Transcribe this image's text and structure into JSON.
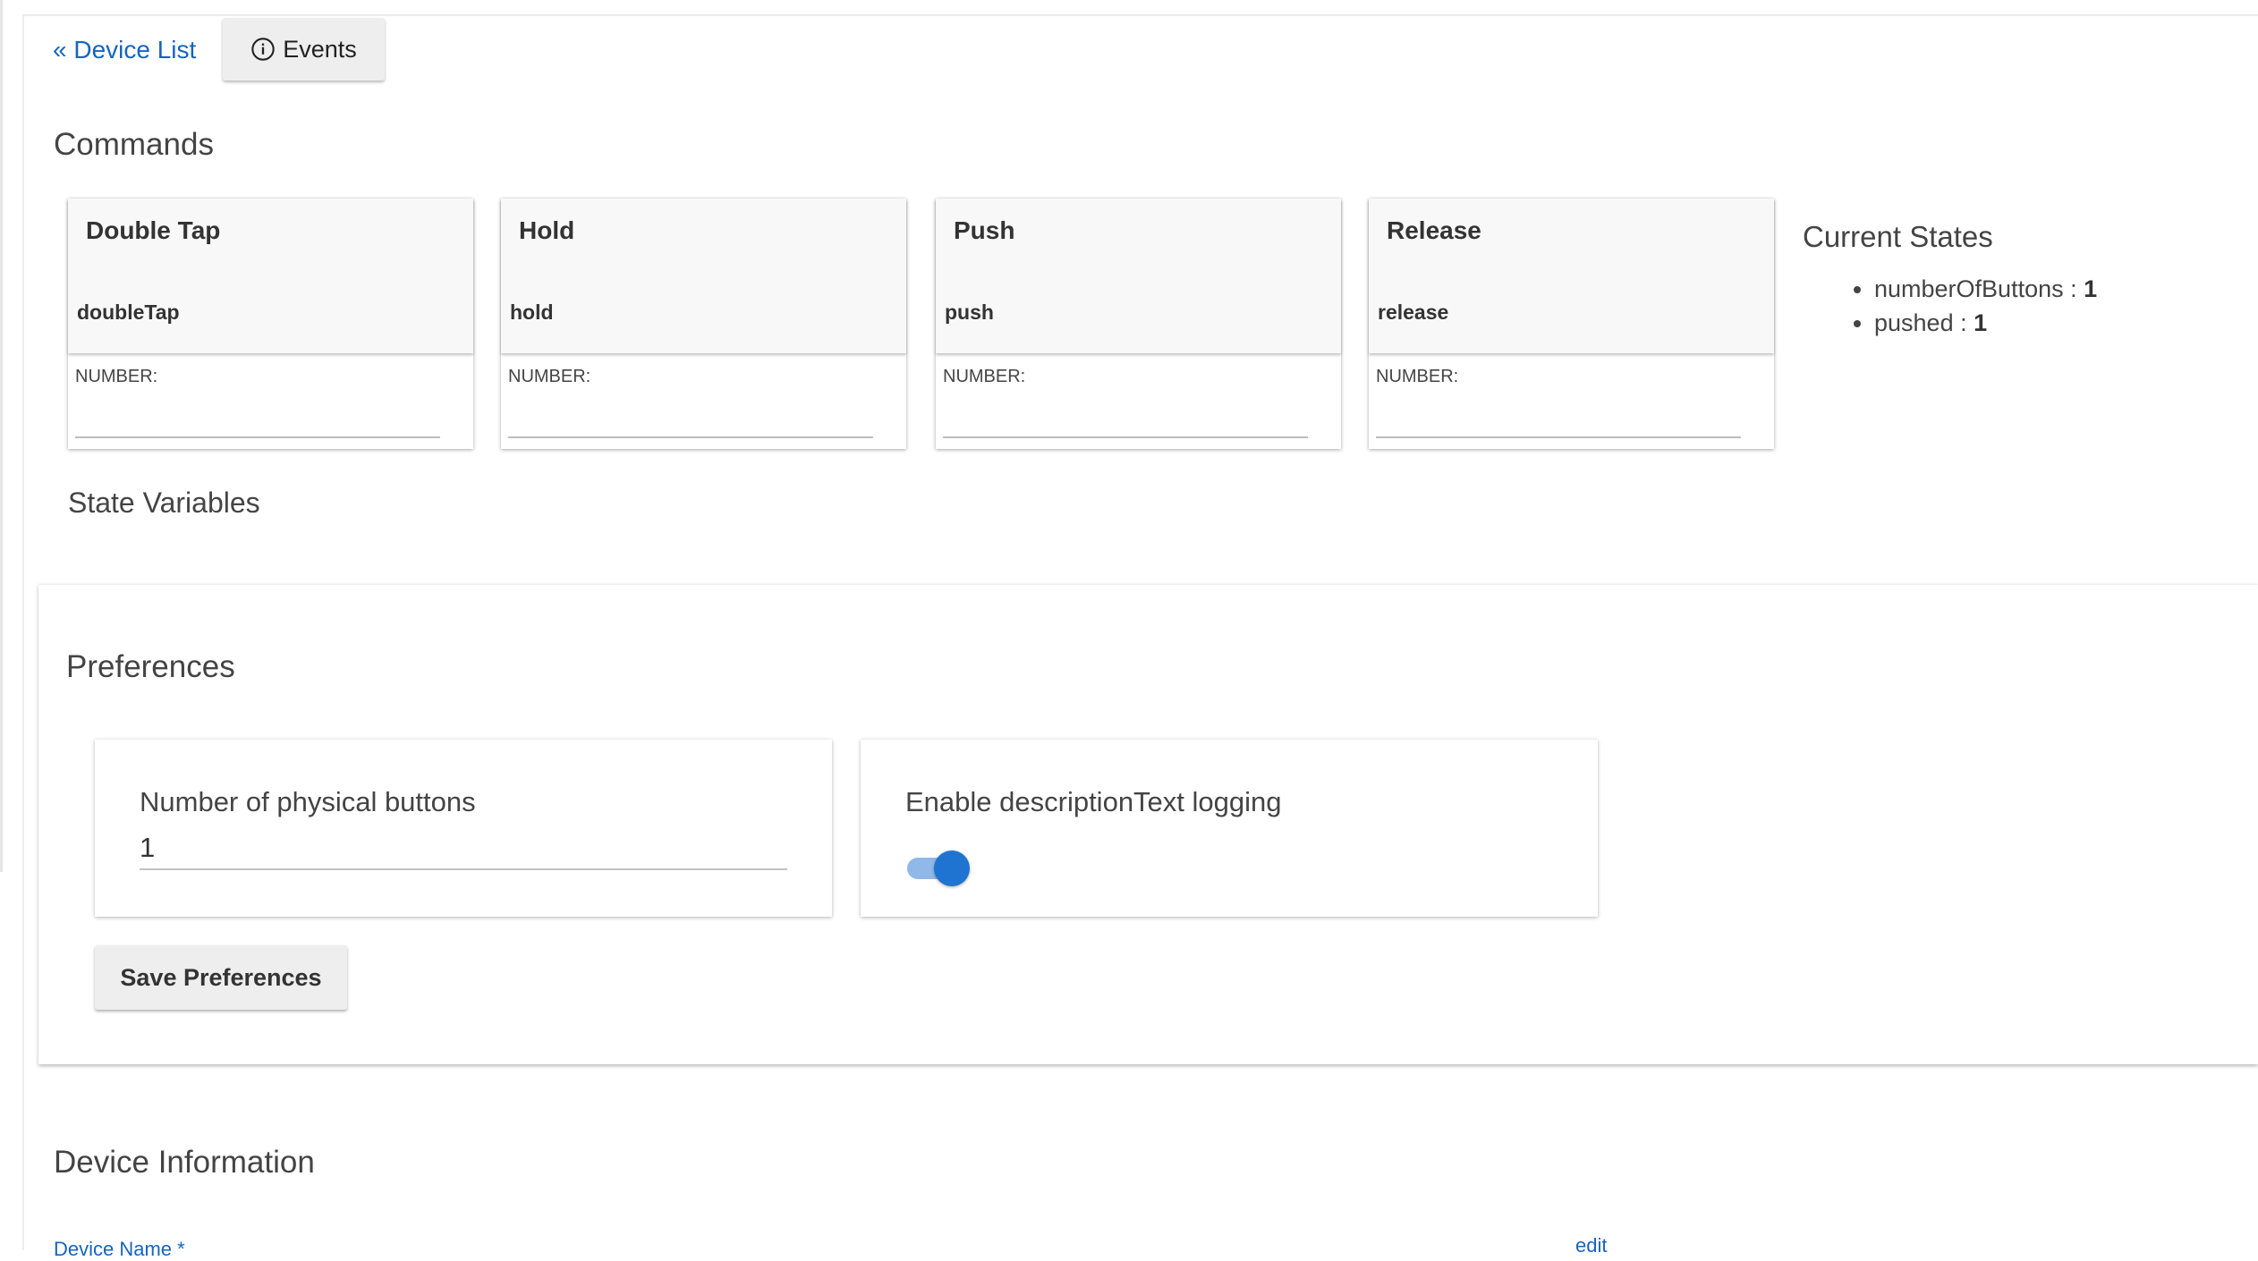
{
  "nav": {
    "back_link": "« Device List",
    "events_label": "Events",
    "events_icon": "info-icon"
  },
  "commands": {
    "title": "Commands",
    "items": [
      {
        "name": "Double Tap",
        "method": "doubleTap",
        "param_label": "NUMBER:",
        "param_value": ""
      },
      {
        "name": "Hold",
        "method": "hold",
        "param_label": "NUMBER:",
        "param_value": ""
      },
      {
        "name": "Push",
        "method": "push",
        "param_label": "NUMBER:",
        "param_value": ""
      },
      {
        "name": "Release",
        "method": "release",
        "param_label": "NUMBER:",
        "param_value": ""
      }
    ]
  },
  "current_states": {
    "title": "Current States",
    "items": [
      {
        "name": "numberOfButtons",
        "sep": " : ",
        "value": "1"
      },
      {
        "name": "pushed",
        "sep": " : ",
        "value": "1"
      }
    ]
  },
  "state_variables": {
    "title": "State Variables"
  },
  "preferences": {
    "title": "Preferences",
    "number_of_buttons": {
      "label": "Number of physical buttons",
      "value": "1"
    },
    "description_logging": {
      "label": "Enable descriptionText logging",
      "enabled": true
    },
    "save_label": "Save Preferences"
  },
  "device_information": {
    "title": "Device Information",
    "device_name_label": "Device Name *",
    "edit_label": "edit"
  },
  "colors": {
    "link": "#1565c0",
    "toggle_on": "#1e74d0",
    "toggle_track": "#90b8e8"
  }
}
